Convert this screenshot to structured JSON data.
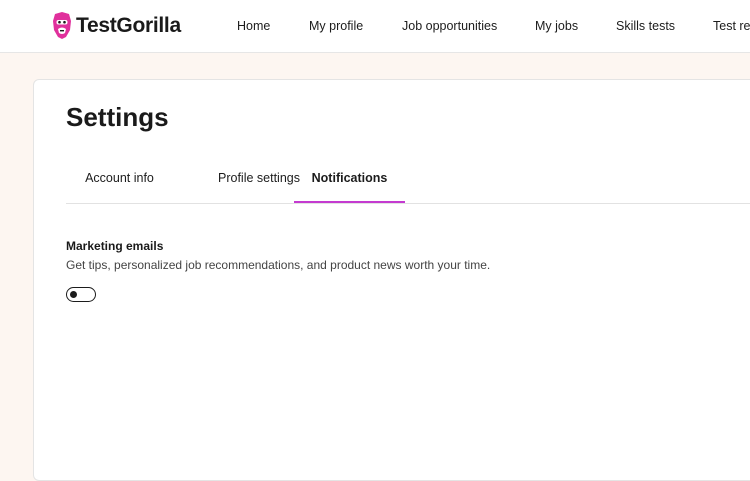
{
  "brand": {
    "name": "TestGorilla",
    "accent_color": "#e0309c"
  },
  "nav": {
    "items": [
      "Home",
      "My profile",
      "Job opportunities",
      "My jobs",
      "Skills tests",
      "Test re"
    ]
  },
  "settings": {
    "title": "Settings",
    "tabs": [
      {
        "label": "Account info",
        "active": false
      },
      {
        "label": "Profile settings",
        "active": false
      },
      {
        "label": "Notifications",
        "active": true
      }
    ],
    "active_tab_color": "#c43ad0"
  },
  "notifications": {
    "marketing": {
      "title": "Marketing emails",
      "description": "Get tips, personalized job recommendations, and product news worth your time.",
      "enabled": false
    }
  }
}
